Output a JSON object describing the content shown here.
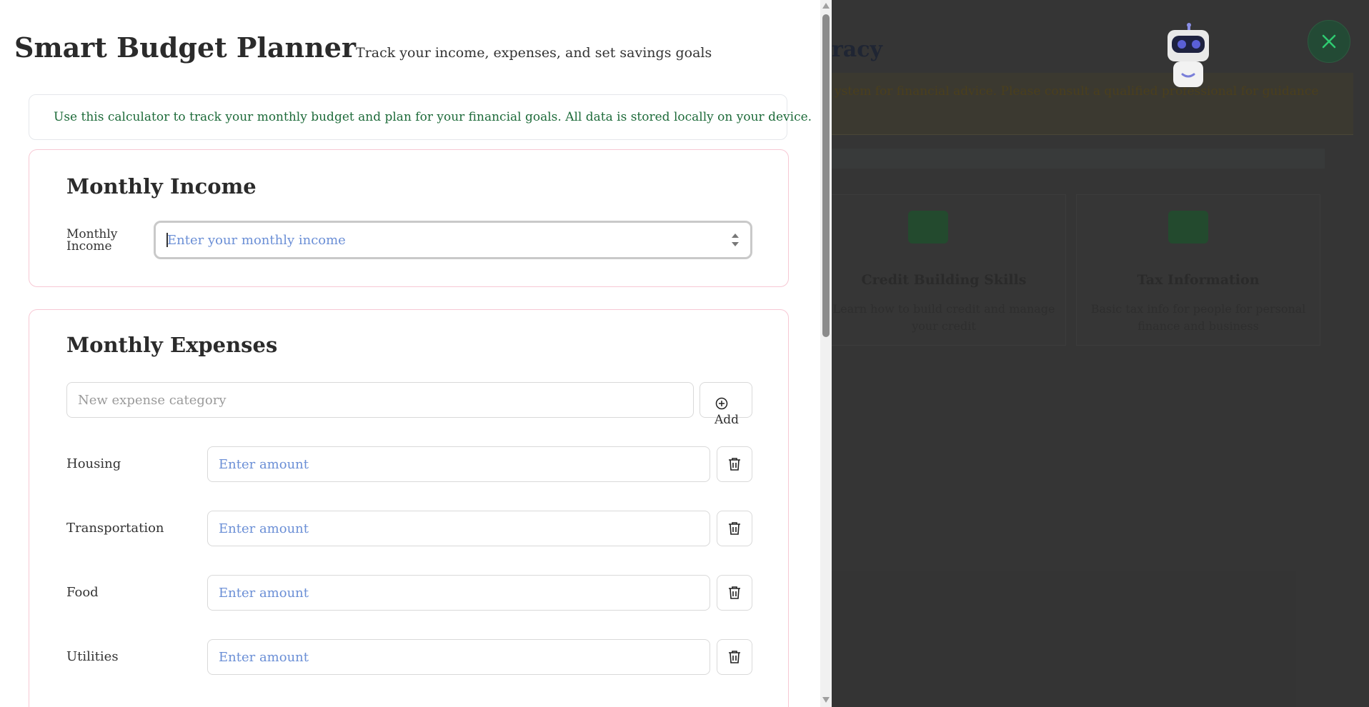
{
  "header": {
    "title": "Smart Budget Planner",
    "subtitle": "Track your income, expenses, and set savings goals"
  },
  "info": {
    "text": "Use this calculator to track your monthly budget and plan for your financial goals. All data is stored locally on your device.",
    "icon": "alert-circle-icon"
  },
  "income": {
    "title": "Monthly Income",
    "label": "Monthly Income",
    "placeholder": "Enter your monthly income"
  },
  "expenses": {
    "title": "Monthly Expenses",
    "new_category_placeholder": "New expense category",
    "add_label": "Add",
    "amount_placeholder": "Enter amount",
    "items": [
      {
        "label": "Housing"
      },
      {
        "label": "Transportation"
      },
      {
        "label": "Food"
      },
      {
        "label": "Utilities"
      }
    ]
  },
  "background": {
    "title_fragment": "racy",
    "alert_text": "ystem for financial advice. Please consult a qualified professional for guidance",
    "cards": [
      {
        "title": "Credit Building Skills",
        "desc": "Learn how to build credit and manage your credit"
      },
      {
        "title": "Tax Information",
        "desc": "Basic tax info for people for personal finance and business"
      }
    ]
  },
  "colors": {
    "accent_green": "#1e6b3a",
    "placeholder_blue": "#6b8fd6",
    "card_border": "#f7c8d4",
    "close_icon": "#2ecc71"
  }
}
